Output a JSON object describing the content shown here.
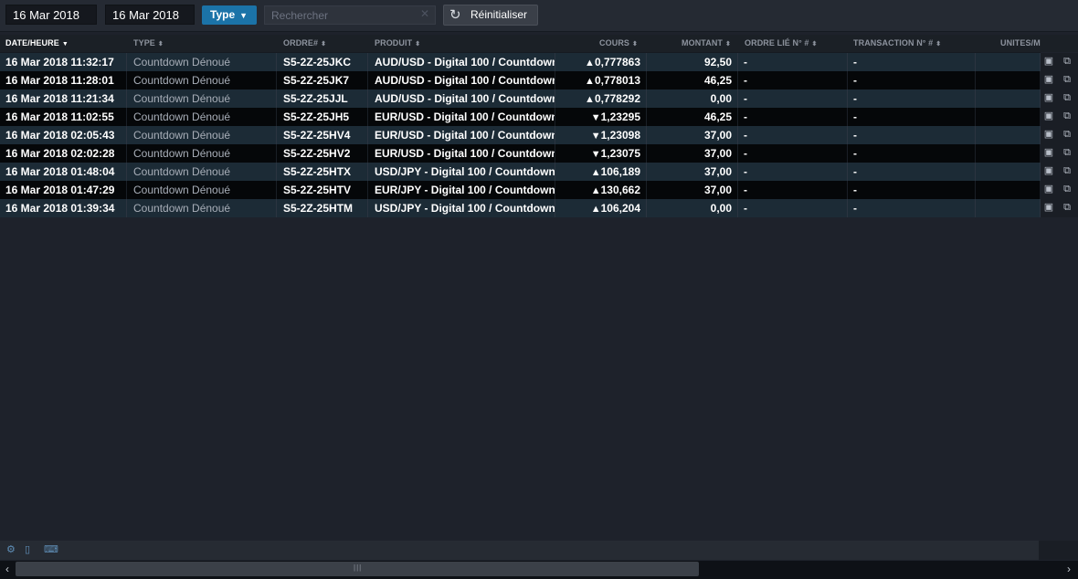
{
  "toolbar": {
    "date_from": "16 Mar 2018",
    "date_to": "16 Mar 2018",
    "type_label": "Type",
    "search_placeholder": "Rechercher",
    "reset_label": "Réinitialiser"
  },
  "columns": [
    {
      "key": "date",
      "label": "DATE/HEURE",
      "sort": "desc",
      "active": true
    },
    {
      "key": "type",
      "label": "TYPE",
      "sort": "both"
    },
    {
      "key": "ordre",
      "label": "ORDRE#",
      "sort": "both"
    },
    {
      "key": "produit",
      "label": "PRODUIT",
      "sort": "both"
    },
    {
      "key": "cours",
      "label": "COURS",
      "sort": "both"
    },
    {
      "key": "montant",
      "label": "MONTANT",
      "sort": "both"
    },
    {
      "key": "ordre_lie",
      "label": "ORDRE LIÉ N° #",
      "sort": "both"
    },
    {
      "key": "transaction",
      "label": "TRANSACTION N° #",
      "sort": "both"
    },
    {
      "key": "unites",
      "label": "UNITES/M",
      "sort": "none"
    }
  ],
  "rows": [
    {
      "date": "16 Mar 2018 11:32:17",
      "type": "Countdown Dénoué",
      "ordre": "S5-2Z-25JKC",
      "produit": "AUD/USD - Digital 100 / Countdown",
      "direction": "up",
      "cours": "0,777863",
      "montant": "92,50",
      "ordre_lie": "-",
      "transaction": "-"
    },
    {
      "date": "16 Mar 2018 11:28:01",
      "type": "Countdown Dénoué",
      "ordre": "S5-2Z-25JK7",
      "produit": "AUD/USD - Digital 100 / Countdown",
      "direction": "up",
      "cours": "0,778013",
      "montant": "46,25",
      "ordre_lie": "-",
      "transaction": "-"
    },
    {
      "date": "16 Mar 2018 11:21:34",
      "type": "Countdown Dénoué",
      "ordre": "S5-2Z-25JJL",
      "produit": "AUD/USD - Digital 100 / Countdown",
      "direction": "up",
      "cours": "0,778292",
      "montant": "0,00",
      "ordre_lie": "-",
      "transaction": "-"
    },
    {
      "date": "16 Mar 2018 11:02:55",
      "type": "Countdown Dénoué",
      "ordre": "S5-2Z-25JH5",
      "produit": "EUR/USD - Digital 100 / Countdown",
      "direction": "down",
      "cours": "1,23295",
      "montant": "46,25",
      "ordre_lie": "-",
      "transaction": "-"
    },
    {
      "date": "16 Mar 2018 02:05:43",
      "type": "Countdown Dénoué",
      "ordre": "S5-2Z-25HV4",
      "produit": "EUR/USD - Digital 100 / Countdown",
      "direction": "down",
      "cours": "1,23098",
      "montant": "37,00",
      "ordre_lie": "-",
      "transaction": "-"
    },
    {
      "date": "16 Mar 2018 02:02:28",
      "type": "Countdown Dénoué",
      "ordre": "S5-2Z-25HV2",
      "produit": "EUR/USD - Digital 100 / Countdown",
      "direction": "down",
      "cours": "1,23075",
      "montant": "37,00",
      "ordre_lie": "-",
      "transaction": "-"
    },
    {
      "date": "16 Mar 2018 01:48:04",
      "type": "Countdown Dénoué",
      "ordre": "S5-2Z-25HTX",
      "produit": "USD/JPY - Digital 100 / Countdown",
      "direction": "up",
      "cours": "106,189",
      "montant": "37,00",
      "ordre_lie": "-",
      "transaction": "-"
    },
    {
      "date": "16 Mar 2018 01:47:29",
      "type": "Countdown Dénoué",
      "ordre": "S5-2Z-25HTV",
      "produit": "EUR/JPY - Digital 100 / Countdown",
      "direction": "up",
      "cours": "130,662",
      "montant": "37,00",
      "ordre_lie": "-",
      "transaction": "-"
    },
    {
      "date": "16 Mar 2018 01:39:34",
      "type": "Countdown Dénoué",
      "ordre": "S5-2Z-25HTM",
      "produit": "USD/JPY - Digital 100 / Countdown",
      "direction": "up",
      "cours": "106,204",
      "montant": "0,00",
      "ordre_lie": "-",
      "transaction": "-"
    }
  ],
  "icons": {
    "sort_desc": "▼",
    "sort_both": "⬍",
    "arrow_up": "▲",
    "arrow_down": "▼",
    "refresh": "↻",
    "clear": "✕",
    "caret": "▼",
    "row_action_1": "computer-icon",
    "row_action_2": "ticket-icon",
    "footer": [
      "gear-icon",
      "document-icon",
      "keyboard-icon"
    ]
  },
  "colors": {
    "accent": "#1b73a8",
    "row_odd": "#1c2b36",
    "row_even": "#050709",
    "background": "#1e222b"
  }
}
